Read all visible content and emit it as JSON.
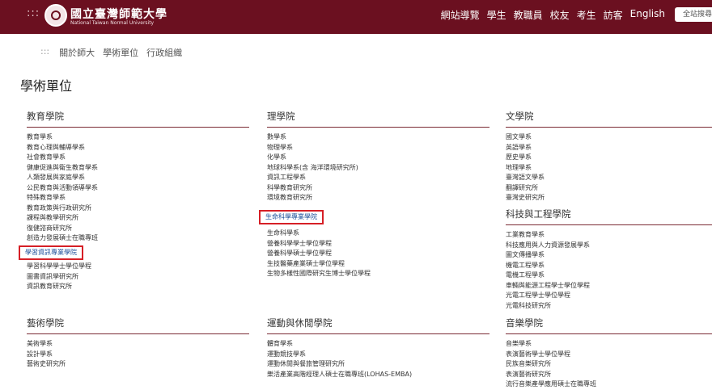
{
  "header": {
    "menu_glyph": ":::",
    "brand_zh": "國立臺灣師範大學",
    "brand_en": "National Taiwan Normal University",
    "nav": [
      "網站導覽",
      "學生",
      "教職員",
      "校友",
      "考生",
      "訪客",
      "English"
    ],
    "search_label": "全站搜尋"
  },
  "breadcrumb": {
    "dots": ":::",
    "items": [
      "關於師大",
      "學術單位",
      "行政組織"
    ]
  },
  "page_title": "學術單位",
  "colleges": [
    {
      "title": "教育學院",
      "items": [
        "教育學系",
        "教育心理與輔導學系",
        "社會教育學系",
        "健康促進與衛生教育學系",
        "人類發展與家庭學系",
        "公民教育與活動領導學系",
        "特殊教育學系",
        "教育政策與行政研究所",
        "課程與教學研究所",
        "復健諮商研究所",
        "創造力發展碩士在職專班",
        "學習資訊專業學院",
        "學習科學學士學位學程",
        "圖書資訊學研究所",
        "資訊教育研究所"
      ]
    },
    {
      "title": "理學院",
      "items": [
        "數學系",
        "物理學系",
        "化學系",
        "地球科學系(含 海洋環境研究所)",
        "資訊工程學系",
        "科學教育研究所",
        "環境教育研究所",
        "生命科學專業學院",
        "生命科學系",
        "營養科學學士學位學程",
        "營養科學碩士學位學程",
        "生技醫藥產業碩士學位學程",
        "生物多樣性國際研究生博士學位學程"
      ]
    },
    {
      "title": "文學院",
      "items": [
        "國文學系",
        "英語學系",
        "歷史學系",
        "地理學系",
        "臺灣語文學系",
        "翻譯研究所",
        "臺灣史研究所"
      ]
    },
    {
      "title": "科技與工程學院",
      "items": [
        "工業教育學系",
        "科技應用與人力資源發展學系",
        "圖文傳播學系",
        "機電工程學系",
        "電機工程學系",
        "車輛與能源工程學士學位學程",
        "光電工程學士學位學程",
        "光電科技研究所"
      ]
    },
    {
      "title": "藝術學院",
      "items": [
        "美術學系",
        "設計學系",
        "藝術史研究所"
      ]
    },
    {
      "title": "運動與休閒學院",
      "items": [
        "體育學系",
        "運動競技學系",
        "運動休閒與餐旅管理研究所",
        "樂活產業高階經理人碩士在職專班(LOHAS-EMBA)"
      ]
    },
    {
      "title": "音樂學院",
      "items": [
        "音樂學系",
        "表演藝術學士學位學程",
        "民族音樂研究所",
        "表演藝術研究所",
        "流行音樂產學應用碩士在職專班"
      ]
    }
  ],
  "accent_color": "#6b1020",
  "highlight_color": "#d61f26"
}
